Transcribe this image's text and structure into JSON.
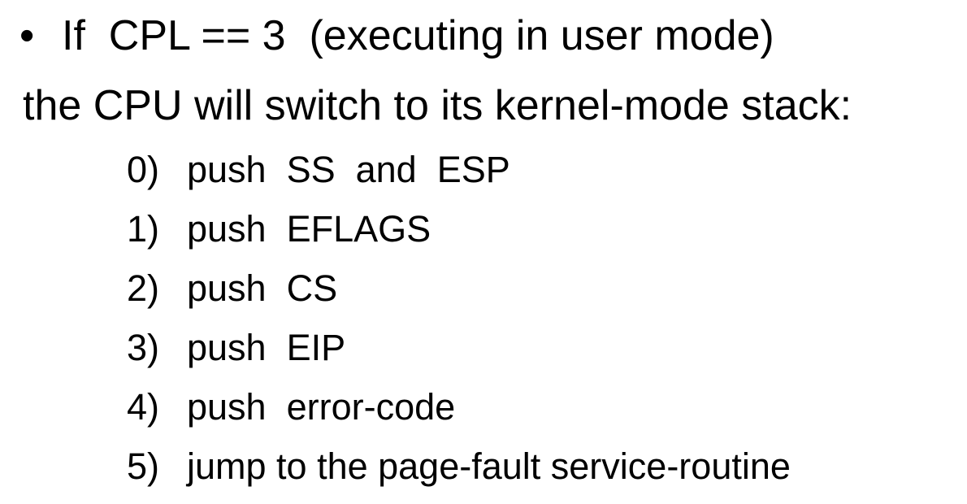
{
  "slide": {
    "bullet": {
      "marker": "•",
      "text": "If  CPL == 3  (executing in user mode)"
    },
    "continuation": "the CPU will switch to its kernel-mode stack:",
    "steps": [
      {
        "num": "0)",
        "text": "push  SS  and  ESP"
      },
      {
        "num": "1)",
        "text": "push  EFLAGS"
      },
      {
        "num": "2)",
        "text": "push  CS"
      },
      {
        "num": "3)",
        "text": "push  EIP"
      },
      {
        "num": "4)",
        "text": "push  error-code"
      },
      {
        "num": "5)",
        "text": "jump to the page-fault service-routine"
      }
    ]
  }
}
